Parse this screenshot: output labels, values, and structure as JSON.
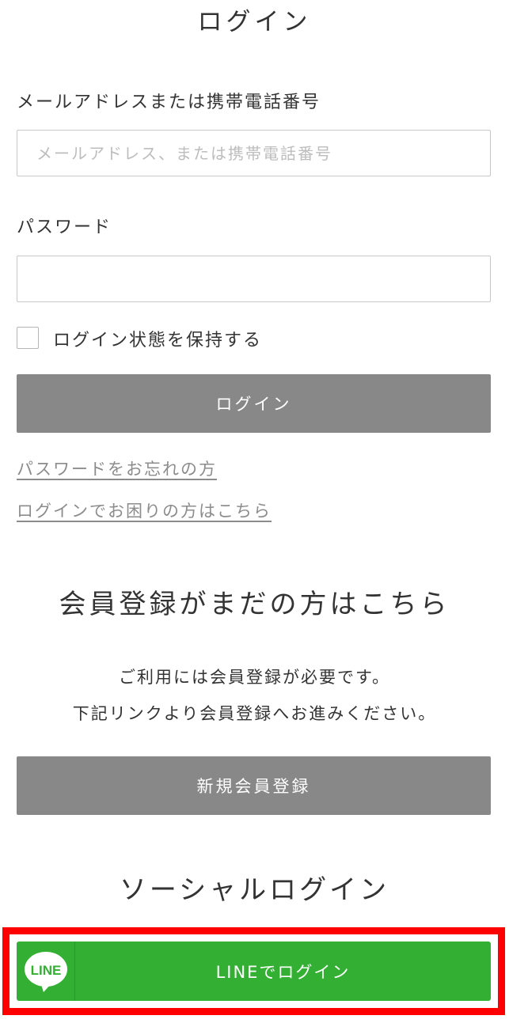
{
  "page": {
    "title": "ログイン"
  },
  "login_form": {
    "email_label": "メールアドレスまたは携帯電話番号",
    "email_value": "",
    "email_placeholder": "メールアドレス、または携帯電話番号",
    "password_label": "パスワード",
    "password_value": "",
    "password_placeholder": "",
    "remember_checked": false,
    "remember_label": "ログイン状態を保持する",
    "submit_label": "ログイン"
  },
  "links": {
    "forgot_password": "パスワードをお忘れの方",
    "login_help": "ログインでお困りの方はこちら"
  },
  "register": {
    "title": "会員登録がまだの方はこちら",
    "line1": "ご利用には会員登録が必要です。",
    "line2": "下記リンクより会員登録へお進みください。",
    "button_label": "新規会員登録"
  },
  "social": {
    "title": "ソーシャルログイン",
    "line_button_label": "LINEでログイン",
    "line_logo_text": "LINE",
    "line_icon": "line-logo-icon"
  },
  "colors": {
    "gray_button": "#888888",
    "line_green": "#33b033",
    "highlight_red": "#ff0000",
    "link_gray": "#8c8c8c"
  }
}
